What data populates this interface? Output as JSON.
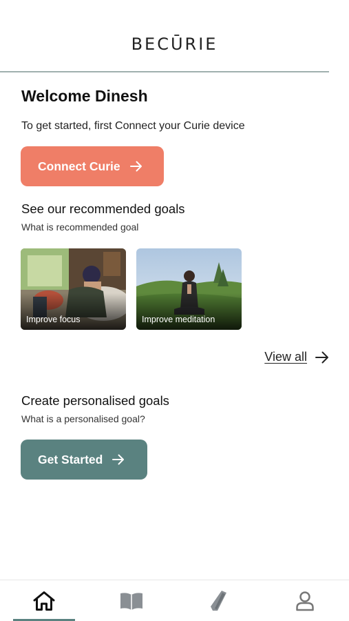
{
  "header": {
    "logo": "BECŪRIE"
  },
  "welcome": {
    "title": "Welcome Dinesh",
    "intro": "To get started, first Connect your Curie device"
  },
  "connect_button": {
    "label": "Connect Curie"
  },
  "recommended": {
    "title": "See our recommended goals",
    "subtitle": "What is recommended goal",
    "cards": [
      {
        "label": "Improve focus"
      },
      {
        "label": "Improve meditation"
      }
    ],
    "view_all": "View all"
  },
  "personalised": {
    "title": "Create personalised goals",
    "subtitle": "What is a personalised goal?",
    "button_label": "Get Started"
  },
  "navbar": {
    "items": [
      {
        "icon": "home-icon",
        "active": true
      },
      {
        "icon": "book-icon",
        "active": false
      },
      {
        "icon": "device-icon",
        "active": false
      },
      {
        "icon": "profile-icon",
        "active": false
      }
    ]
  },
  "colors": {
    "accent_coral": "#ef7e67",
    "accent_teal": "#5a8280"
  }
}
